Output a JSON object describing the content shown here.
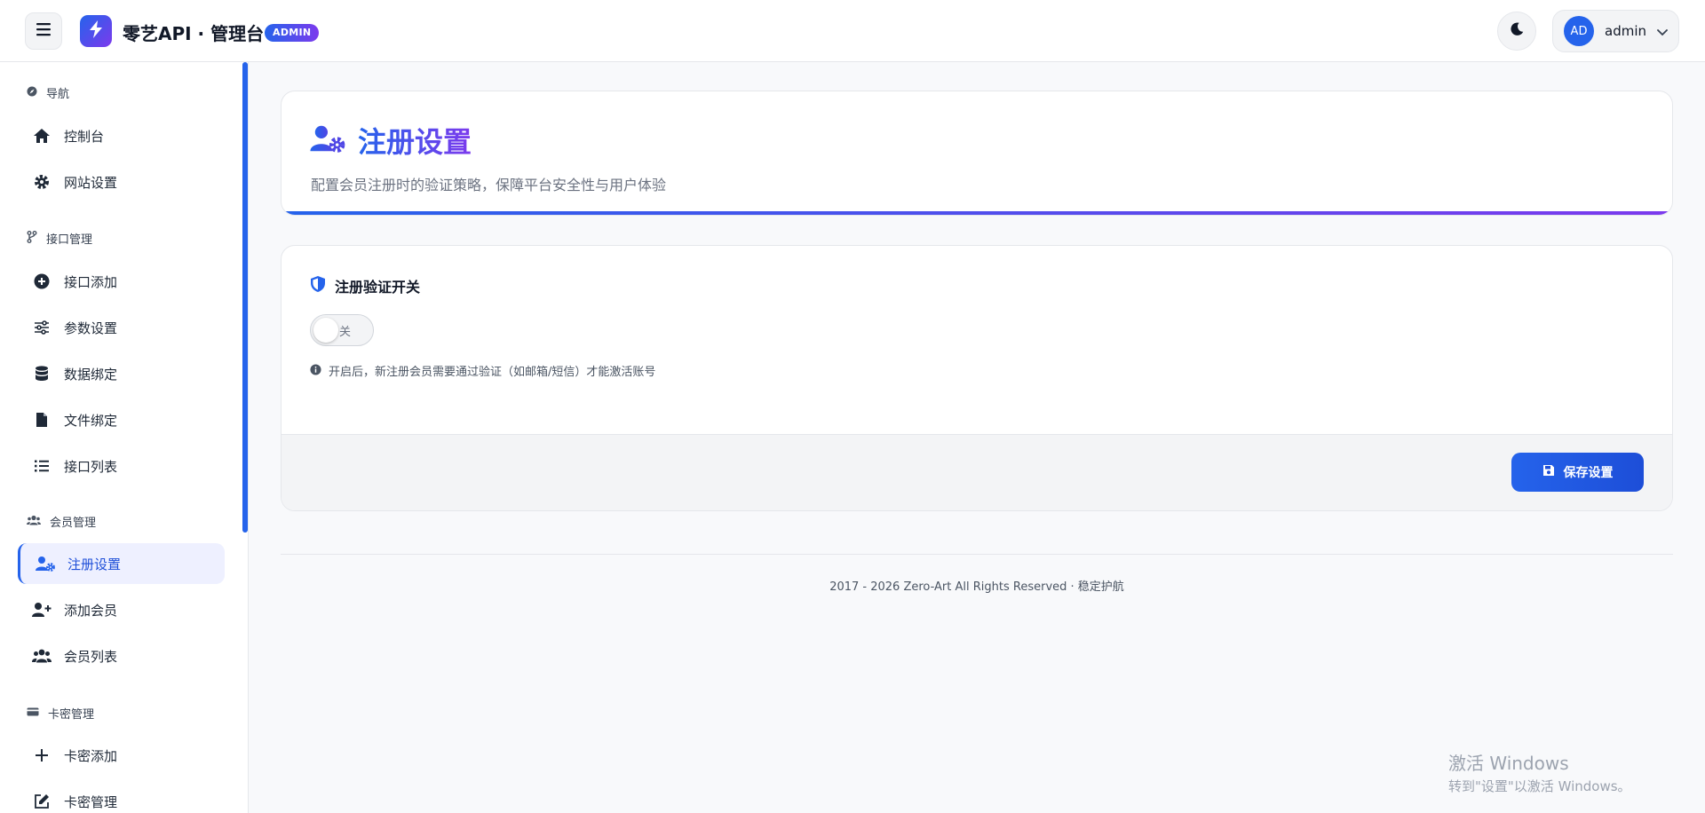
{
  "app": {
    "title": "零艺API · 管理台",
    "badge": "ADMIN",
    "brand_color": "#2563eb",
    "accent_color": "#7c3aed"
  },
  "topbar": {
    "menu_icon": "hamburger-menu-icon",
    "theme_icon": "moon-icon",
    "user": {
      "avatar_initials": "AD",
      "name": "admin"
    }
  },
  "sidebar": {
    "groups": [
      {
        "title": "导航",
        "icon": "compass-icon",
        "items": [
          {
            "label": "控制台",
            "icon": "home-icon"
          },
          {
            "label": "网站设置",
            "icon": "gear-icon"
          }
        ]
      },
      {
        "title": "接口管理",
        "icon": "code-branch-icon",
        "items": [
          {
            "label": "接口添加",
            "icon": "plus-circle-icon"
          },
          {
            "label": "参数设置",
            "icon": "sliders-icon"
          },
          {
            "label": "数据绑定",
            "icon": "database-icon"
          },
          {
            "label": "文件绑定",
            "icon": "file-icon"
          },
          {
            "label": "接口列表",
            "icon": "list-icon"
          }
        ]
      },
      {
        "title": "会员管理",
        "icon": "users-icon",
        "items": [
          {
            "label": "注册设置",
            "icon": "user-gear-icon",
            "active": true
          },
          {
            "label": "添加会员",
            "icon": "user-plus-icon"
          },
          {
            "label": "会员列表",
            "icon": "users-icon"
          }
        ]
      },
      {
        "title": "卡密管理",
        "icon": "card-icon",
        "items": [
          {
            "label": "卡密添加",
            "icon": "plus-icon"
          },
          {
            "label": "卡密管理",
            "icon": "edit-icon"
          }
        ]
      }
    ]
  },
  "page": {
    "title": "注册设置",
    "subtitle": "配置会员注册时的验证策略，保障平台安全性与用户体验"
  },
  "settings": {
    "section_title": "注册验证开关",
    "toggle": {
      "on": false,
      "label": "关闭"
    },
    "hint": "开启后，新注册会员需要通过验证（如邮箱/短信）才能激活账号",
    "save_label": "保存设置"
  },
  "footer": {
    "copyright": "2017 - 2026 Zero-Art All Rights Reserved · 稳定护航"
  },
  "watermark": {
    "title": "激活 Windows",
    "subtitle": "转到\"设置\"以激活 Windows。"
  }
}
